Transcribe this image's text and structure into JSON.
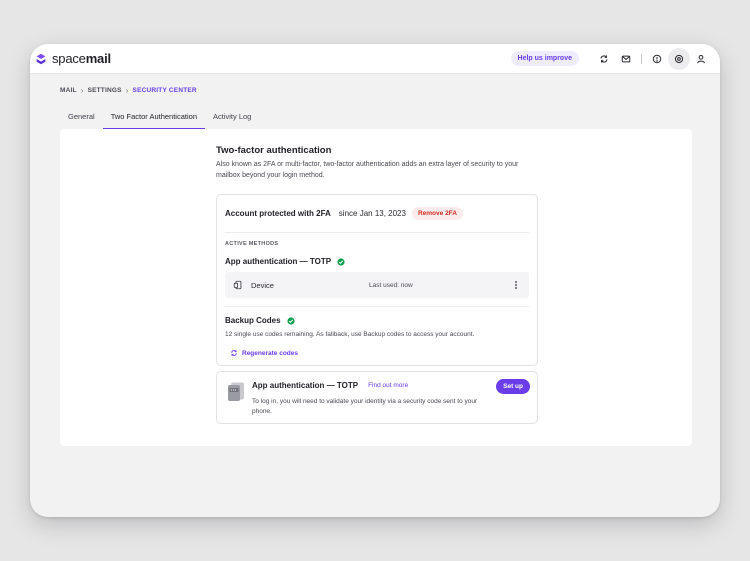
{
  "app": {
    "brand_light": "space",
    "brand_bold": "mail",
    "help_label": "Help us improve",
    "icons": [
      "sync-icon",
      "mail-icon",
      "help-circle-icon",
      "settings-icon",
      "user-icon"
    ]
  },
  "breadcrumb": {
    "items": [
      "MAIL",
      "SETTINGS",
      "SECURITY CENTER"
    ]
  },
  "tabs": [
    "General",
    "Two Factor Authentication",
    "Activity Log"
  ],
  "section": {
    "title": "Two-factor authentication",
    "description": "Also known as 2FA or multi-factor, two-factor authentication adds an extra layer of security to your mailbox beyond your login method."
  },
  "protected_card": {
    "title": "Account protected with 2FA",
    "since": "since Jan 13, 2023",
    "remove_label": "Remove 2FA",
    "active_methods_label": "ACTIVE METHODS",
    "method_title": "App authentication — TOTP",
    "device_name": "Device",
    "last_used": "Last used: now",
    "backup_title": "Backup Codes",
    "backup_desc": "12 single use codes remaining. As fallback, use Backup codes to access your account.",
    "regenerate_label": "Regenerate codes"
  },
  "setup_card": {
    "title": "App authentication — TOTP",
    "link": "Find out more",
    "description": "To log in, you will need to validate your identity via a security code sent to your phone.",
    "button": "Set up"
  },
  "colors": {
    "accent": "#6a3de8",
    "danger": "#d92d20",
    "success": "#12a150"
  }
}
